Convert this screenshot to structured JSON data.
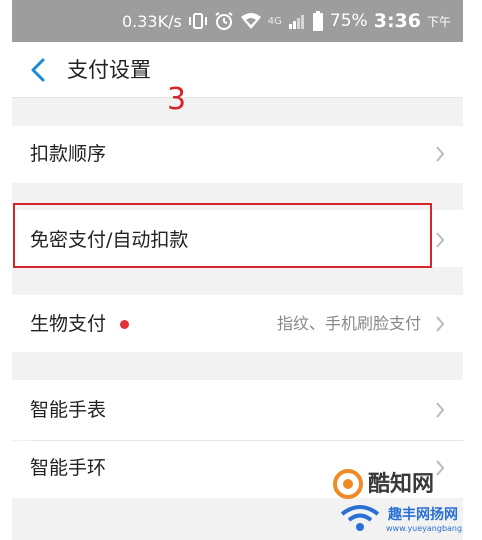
{
  "status_bar": {
    "speed": "0.33K/s",
    "network": "4G",
    "battery": "75%",
    "time": "3:36",
    "ampm": "下午",
    "icons": [
      "vibrate-icon",
      "alarm-icon",
      "wifi-icon",
      "signal-icon",
      "battery-icon"
    ]
  },
  "nav": {
    "back_icon": "chevron-left-icon",
    "title": "支付设置"
  },
  "annotation": {
    "number": "3",
    "color": "#d4252b"
  },
  "settings": {
    "deduction_order": {
      "label": "扣款顺序"
    },
    "password_free": {
      "label": "免密支付/自动扣款"
    },
    "biometric": {
      "label": "生物支付",
      "value": "指纹、手机刷脸支付"
    },
    "smart_watch": {
      "label": "智能手表"
    },
    "smart_band": {
      "label": "智能手环"
    }
  },
  "watermark": {
    "brand": "酷知网",
    "tagline": "趣丰网扬网",
    "url": "www.yueyangbang.com"
  },
  "colors": {
    "accent": "#1a8ad4",
    "status_bar": "#9d9d9d",
    "background": "#f2f2f2",
    "highlight": "#d4252b",
    "red_dot": "#e3323a"
  }
}
